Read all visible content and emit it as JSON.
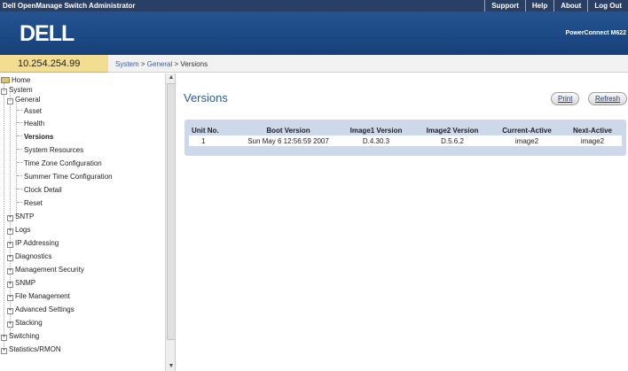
{
  "window": {
    "title": "Dell OpenManage Switch Administrator",
    "links": [
      "Support",
      "Help",
      "About",
      "Log Out"
    ]
  },
  "banner": {
    "logo": "DELL",
    "model": "PowerConnect M622"
  },
  "ip_address": "10.254.254.99",
  "breadcrumb": {
    "system": "System",
    "general": "General",
    "current": "Versions",
    "separator": " > "
  },
  "tree": {
    "home": "Home",
    "system": "System",
    "general": "General",
    "asset": "Asset",
    "health": "Health",
    "versions": "Versions",
    "system_resources": "System Resources",
    "time_zone": "Time Zone Configuration",
    "summer_time": "Summer Time Configuration",
    "clock_detail": "Clock Detail",
    "reset": "Reset",
    "sntp": "SNTP",
    "logs": "Logs",
    "ip_addressing": "IP Addressing",
    "diagnostics": "Diagnostics",
    "management_security": "Management Security",
    "snmp": "SNMP",
    "file_management": "File Management",
    "advanced_settings": "Advanced Settings",
    "stacking": "Stacking",
    "switching": "Switching",
    "statistics_rmon": "Statistics/RMON"
  },
  "page": {
    "title": "Versions",
    "print_label": "Print",
    "refresh_label": "Refresh"
  },
  "table": {
    "headers": [
      "Unit No.",
      "Boot Version",
      "Image1 Version",
      "Image2 Version",
      "Current-Active",
      "Next-Active"
    ],
    "rows": [
      [
        "1",
        "Sun May 6 12:56:59 2007",
        "D.4.30.3",
        "D.5.6.2",
        "image2",
        "image2"
      ]
    ]
  },
  "colors": {
    "topbar": "#2a3f66",
    "banner": "#1c4a86",
    "ip_box": "#f3dd91",
    "title": "#2f5a95",
    "table_frame": "#cdd9ea"
  }
}
